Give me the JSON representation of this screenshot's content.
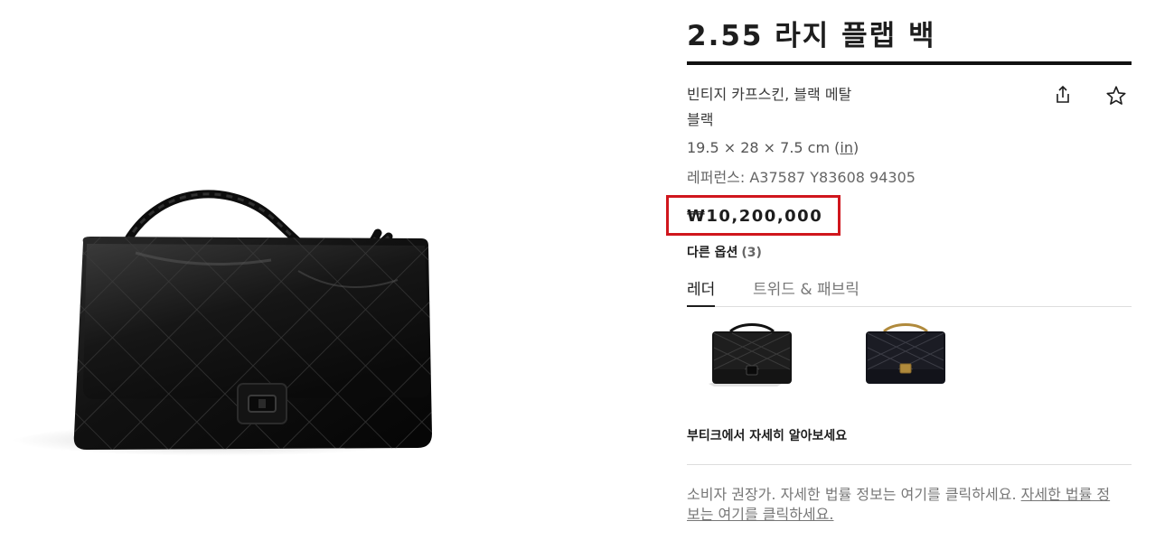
{
  "product": {
    "title": "2.55 라지 플랩 백",
    "material": "빈티지 카프스킨, 블랙 메탈",
    "color": "블랙",
    "dimensions": "19.5 × 28 × 7.5 cm",
    "dimensions_open_paren": "(",
    "dimensions_unit_link": "in",
    "dimensions_close_paren": ")",
    "reference": "레퍼런스: A37587 Y83608 94305",
    "price": "₩10,200,000"
  },
  "actions": {
    "share_icon": "share-icon",
    "favorite_icon": "star-icon"
  },
  "options": {
    "title": "다른 옵션",
    "count": "(3)",
    "tabs": [
      {
        "label": "레더",
        "active": true
      },
      {
        "label": "트위드 & 패브릭",
        "active": false
      }
    ],
    "thumbnails": [
      {
        "name": "black-metal-bag",
        "hardware": "black"
      },
      {
        "name": "gold-metal-bag",
        "hardware": "gold"
      }
    ]
  },
  "boutique_link": "부티크에서 자세히 알아보세요",
  "legal": {
    "text": "소비자 권장가. 자세한 법률 정보는 여기를 클릭하세요.",
    "link": "자세한 법률 정보는 여기를 클릭하세요."
  },
  "colors": {
    "accent_highlight": "#d0161d",
    "text_primary": "#1d1d1d",
    "text_muted": "#777777"
  }
}
